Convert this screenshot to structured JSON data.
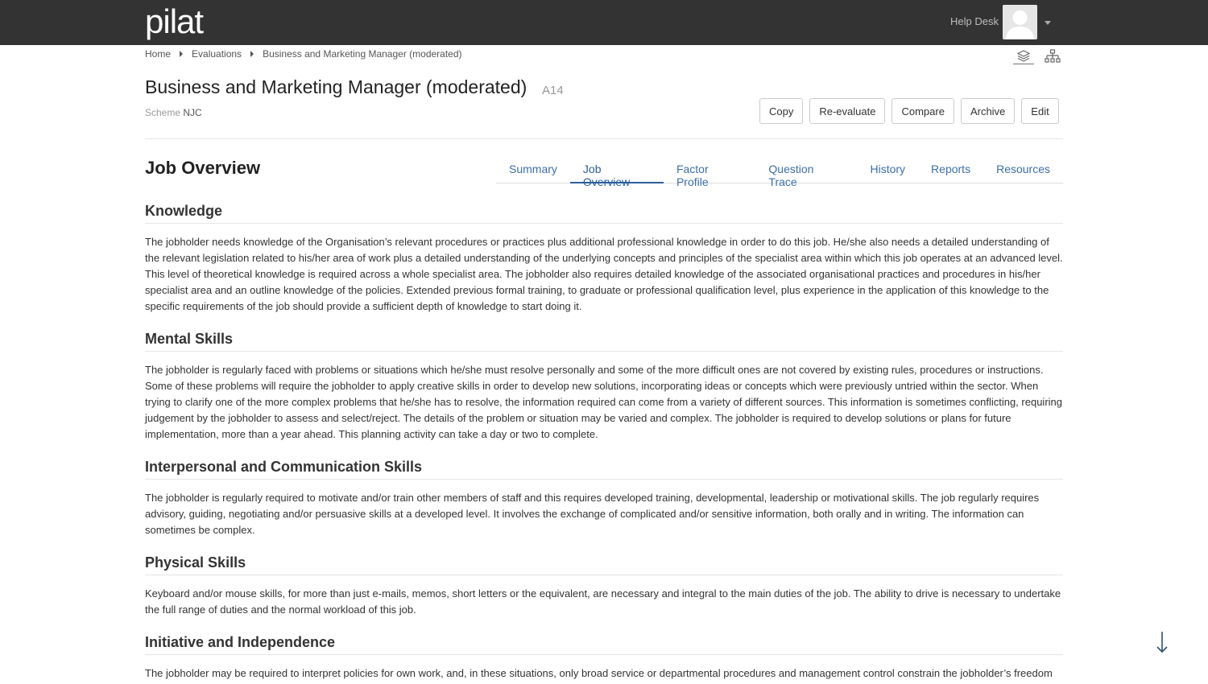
{
  "app": {
    "logo": "pilat"
  },
  "topbar": {
    "help_desk": "Help Desk"
  },
  "breadcrumb": [
    "Home",
    "Evaluations",
    "Business and Marketing Manager (moderated)"
  ],
  "header": {
    "title": "Business and Marketing Manager (moderated)",
    "code": "A14",
    "scheme_label": "Scheme",
    "scheme_value": "NJC"
  },
  "actions": {
    "copy": "Copy",
    "reevaluate": "Re-evaluate",
    "compare": "Compare",
    "archive": "Archive",
    "edit": "Edit"
  },
  "section": {
    "title": "Job Overview"
  },
  "tabs": [
    "Summary",
    "Job Overview",
    "Factor Profile",
    "Question Trace",
    "History",
    "Reports",
    "Resources"
  ],
  "active_tab": "Job Overview",
  "blocks": [
    {
      "heading": "Knowledge",
      "text": "The jobholder needs knowledge of the Organisation’s relevant procedures or practices plus additional professional knowledge in order to do this job. He/she also needs a detailed understanding of the relevant legislation related to his/her area of work plus a detailed understanding of the underlying concepts and principles of the specialist area within which this job operates at an advanced level. This level of theoretical knowledge is required across a whole specialist area. The jobholder also requires detailed knowledge of the associated organisational practices and procedures in his/her specialist area and an outline knowledge of the policies. Extended previous formal training, to graduate or professional qualification level, plus experience in the application of this knowledge to the specific requirements of the job should provide a sufficient depth of knowledge to start doing it."
    },
    {
      "heading": "Mental Skills",
      "text": "The jobholder is regularly faced with problems or situations which he/she must resolve personally and some of the more difficult ones are not covered by existing rules, procedures or instructions. Some of these problems will require the jobholder to apply creative skills in order to develop new solutions, incorporating ideas or concepts which were previously untried within the sector. When trying to clarify one of the more complex problems that he/she has to resolve, the information required can come from a variety of different sources. This information is sometimes conflicting, requiring judgement by the jobholder to assess and select/reject. The details of the problem or situation may be varied and complex. The jobholder is required to develop solutions or plans for future implementation, more than a year ahead. This planning activity can take a day or two to complete."
    },
    {
      "heading": "Interpersonal and Communication Skills",
      "text": "The jobholder is regularly required to motivate and/or train other members of staff and this requires developed training, developmental, leadership or motivational skills. The job regularly requires advisory, guiding, negotiating and/or persuasive skills at a developed level. It involves the exchange of complicated and/or sensitive information, both orally and in writing. The information can sometimes be complex."
    },
    {
      "heading": "Physical Skills",
      "text": "Keyboard and/or mouse skills, for more than just e-mails, memos, short letters or the equivalent, are necessary and integral to the main duties of the job. The ability to drive is necessary to undertake the full range of duties and the normal workload of this job."
    },
    {
      "heading": "Initiative and Independence",
      "text": "The jobholder may be required to interpret policies for own work, and, in these situations, only broad service or departmental procedures and management control constrain the jobholder’s freedom of action. The work involves discretion and initiative over a broad area of activity, although the jobholder is virtually always required to seek advice from more senior"
    }
  ],
  "colors": {
    "topbar": "#333333",
    "accent": "#2b5f9c",
    "tab_link": "#3d6fa8"
  },
  "icons": [
    "layers-icon",
    "hierarchy-icon",
    "user-avatar-icon",
    "caret-down-icon",
    "arrow-down-icon"
  ]
}
